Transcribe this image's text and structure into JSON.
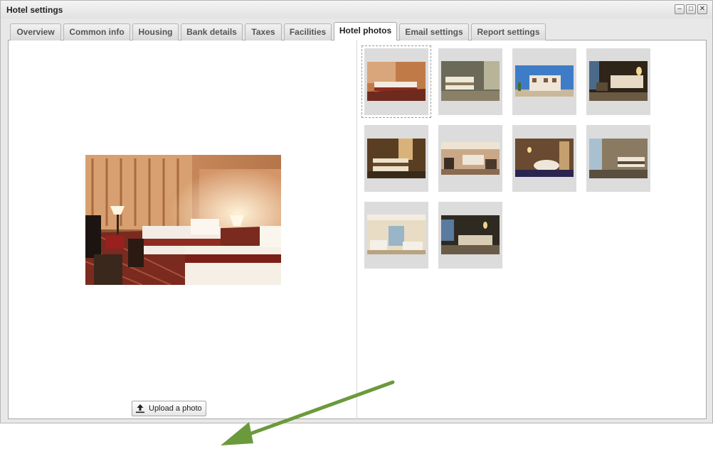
{
  "window": {
    "title": "Hotel settings",
    "controls": {
      "minimize": "–",
      "maximize": "□",
      "close": "✕"
    }
  },
  "tabs": [
    {
      "label": "Overview"
    },
    {
      "label": "Common info"
    },
    {
      "label": "Housing"
    },
    {
      "label": "Bank details"
    },
    {
      "label": "Taxes"
    },
    {
      "label": "Facilities"
    },
    {
      "label": "Hotel photos",
      "active": true
    },
    {
      "label": "Email settings"
    },
    {
      "label": "Report settings"
    }
  ],
  "main_photo": {
    "icon": "hotel-room-photo"
  },
  "upload_button": {
    "label": "Upload a photo",
    "icon": "upload-icon"
  },
  "thumbnails": [
    {
      "scene": "room-warm-lamps",
      "selected": true
    },
    {
      "scene": "room-twin-beds"
    },
    {
      "scene": "hotel-exterior"
    },
    {
      "scene": "room-dark-wood"
    },
    {
      "scene": "room-wide-bed"
    },
    {
      "scene": "room-ceiling-lights"
    },
    {
      "scene": "room-round-bed"
    },
    {
      "scene": "room-window-view"
    },
    {
      "scene": "room-balcony"
    },
    {
      "scene": "room-sea-view"
    }
  ],
  "colors": {
    "annotation_arrow": "#6b9a3c",
    "active_tab": "#ffffff"
  }
}
